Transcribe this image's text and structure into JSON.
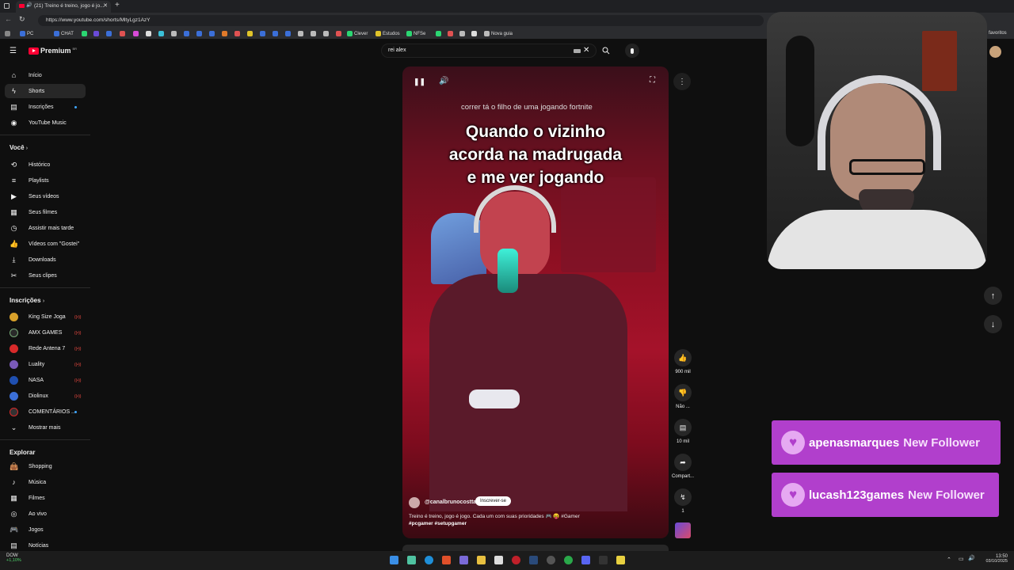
{
  "browser": {
    "tab_title": "(21) Treino é treino, jogo é jo...",
    "url": "https://www.youtube.com/shorts/MltyLgz1AzY",
    "bookmarks": [
      "PC",
      "CHAT",
      "Clever",
      "Estudos",
      "NFSe",
      "Nova guia"
    ],
    "favorites_label": "favoritos"
  },
  "youtube": {
    "logo_text": "Premium",
    "logo_badge": "BR",
    "search_value": "rei alex",
    "nav": [
      {
        "label": "Início",
        "icon": "home-icon"
      },
      {
        "label": "Shorts",
        "icon": "shorts-icon"
      },
      {
        "label": "Inscrições",
        "icon": "subscriptions-icon"
      },
      {
        "label": "YouTube Music",
        "icon": "music-icon"
      }
    ],
    "you_section": {
      "title": "Você",
      "items": [
        "Histórico",
        "Playlists",
        "Seus vídeos",
        "Seus filmes",
        "Assistir mais tarde",
        "Vídeos com \"Gostei\"",
        "Downloads",
        "Seus clipes"
      ]
    },
    "subs_section": {
      "title": "Inscrições",
      "channels": [
        "King Size Joga",
        "AMX GAMES",
        "Rede Antena 7",
        "Luality",
        "NASA",
        "Diolinux",
        "COMENTÁRIOS ..."
      ],
      "show_more": "Mostrar mais"
    },
    "explore_section": {
      "title": "Explorar",
      "items": [
        "Shopping",
        "Música",
        "Filmes",
        "Ao vivo",
        "Jogos",
        "Notícias"
      ]
    }
  },
  "short": {
    "caption_small": "correr tá o filho de uma jogando fortnite",
    "caption_big": [
      "Quando o vizinho",
      "acorda na madrugada",
      "e me ver jogando"
    ],
    "channel": "@canalbrunocostta",
    "subscribe_label": "Inscrever-se",
    "description": "Treino é treino, jogo é jogo. Cada um com suas prioridades 🎮 😝 #Gamer",
    "hashtags": "#pcgamer #setupgamer",
    "likes": "900 mil",
    "dislike_label": "Não ...",
    "comments": "10 mil",
    "share_label": "Compart...",
    "remix_count": "1"
  },
  "overlay": {
    "alerts": [
      {
        "name": "apenasmarques",
        "suffix": "New Follower"
      },
      {
        "name": "lucash123games",
        "suffix": "New Follower"
      }
    ]
  },
  "taskbar": {
    "weather_label": "DOW",
    "weather_value": "+1,10%",
    "time": "13:50",
    "date": "03/10/2025"
  },
  "colors": {
    "yt_red": "#ff0033",
    "alert_purple": "#b13fcc",
    "bg": "#0f0f0f"
  }
}
